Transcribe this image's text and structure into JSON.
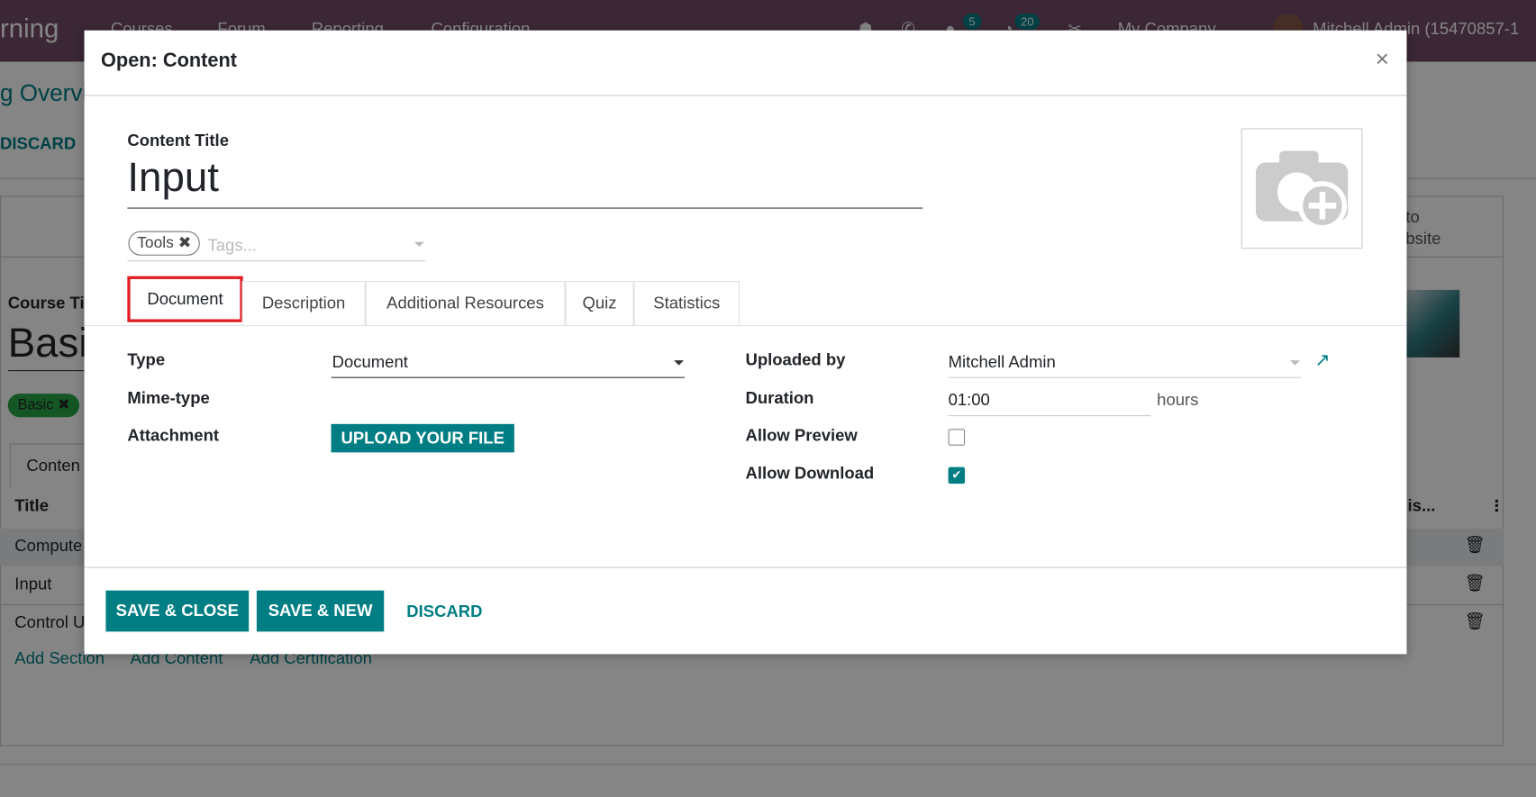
{
  "navbar": {
    "app_name": "rning",
    "menu": [
      "Courses",
      "Forum",
      "Reporting",
      "Configuration"
    ],
    "chat_badge": "5",
    "activity_badge": "20",
    "company": "My Company",
    "user": "Mitchell Admin (15470857-1"
  },
  "background": {
    "breadcrumb": "g Overvi",
    "discard": "DISCARD",
    "website_button": [
      "to",
      "bsite"
    ],
    "course_title_label": "Course Ti",
    "course_title": "Basi",
    "tag": "Basic",
    "tab": "Conten",
    "table_header_title": "Title",
    "table_header_right": "is...",
    "rows": [
      "Compute",
      "Input",
      "Control U"
    ],
    "links": [
      "Add Section",
      "Add Content",
      "Add Certification"
    ]
  },
  "modal": {
    "title": "Open: Content",
    "close": "×",
    "content_title_label": "Content Title",
    "content_title": "Input",
    "tags": [
      "Tools"
    ],
    "tags_placeholder": "Tags...",
    "tabs": [
      "Document",
      "Description",
      "Additional Resources",
      "Quiz",
      "Statistics"
    ],
    "active_tab": "Document",
    "fields_left": {
      "type_label": "Type",
      "type_value": "Document",
      "mime_label": "Mime-type",
      "attachment_label": "Attachment",
      "upload_button": "UPLOAD YOUR FILE"
    },
    "fields_right": {
      "uploaded_by_label": "Uploaded by",
      "uploaded_by_value": "Mitchell Admin",
      "duration_label": "Duration",
      "duration_value": "01:00",
      "duration_unit": "hours",
      "allow_preview_label": "Allow Preview",
      "allow_preview": false,
      "allow_download_label": "Allow Download",
      "allow_download": true
    },
    "footer": {
      "save_close": "SAVE & CLOSE",
      "save_new": "SAVE & NEW",
      "discard": "DISCARD"
    }
  },
  "colors": {
    "brand": "#714b67",
    "accent": "#017e84",
    "highlight": "#e31b23",
    "tag_green": "#28a745"
  }
}
